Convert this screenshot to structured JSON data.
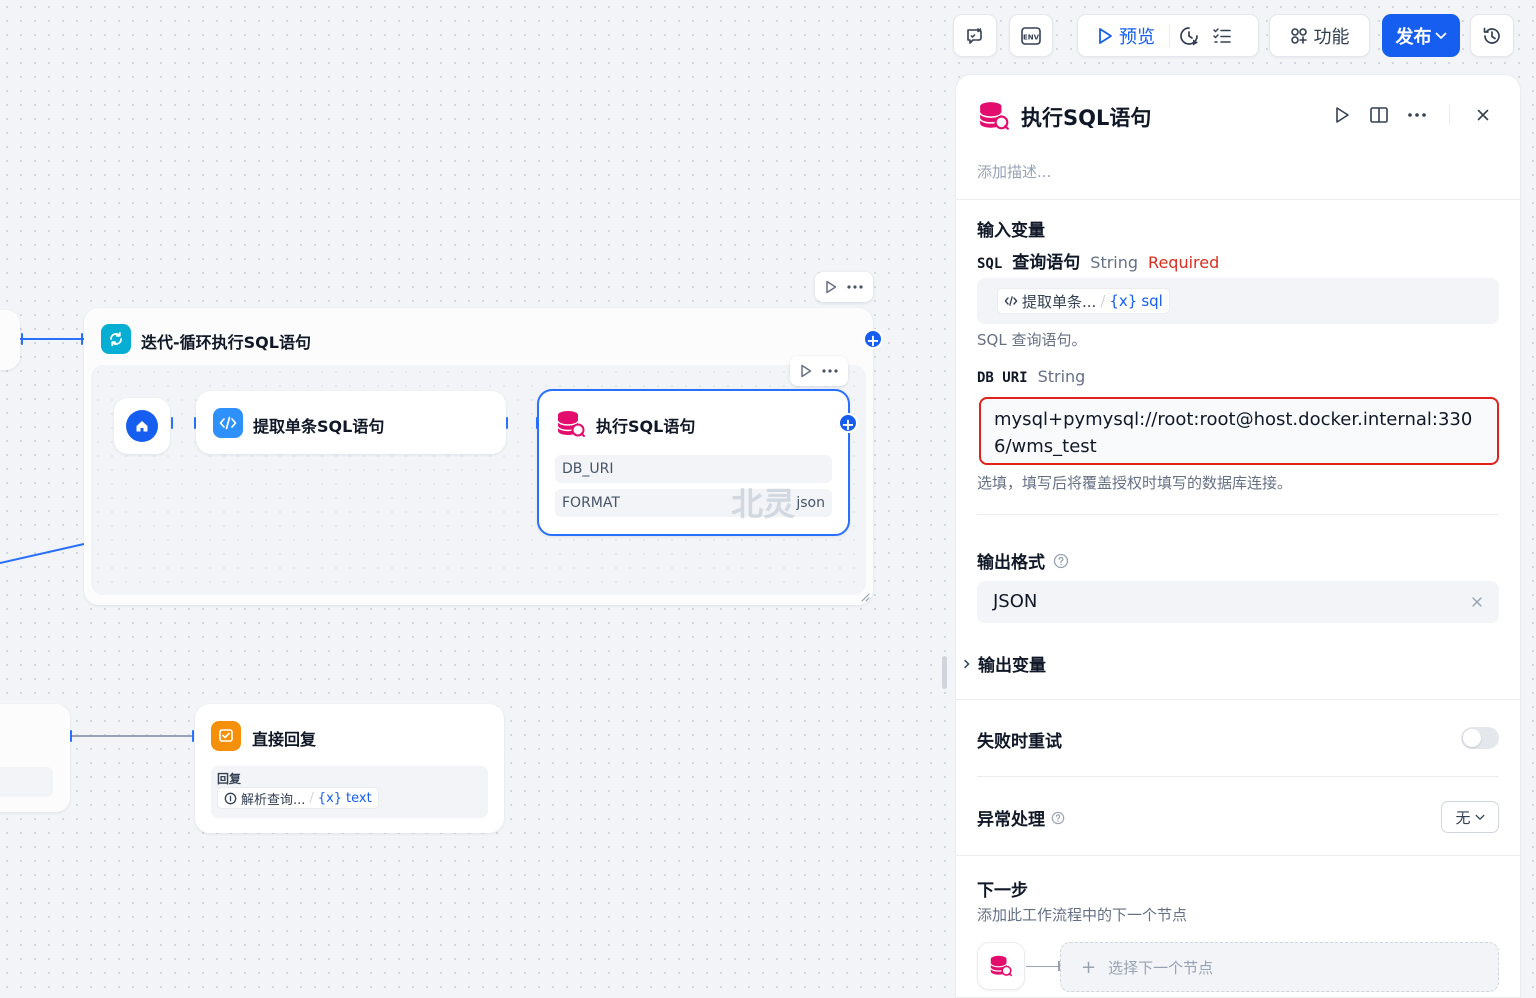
{
  "toolbar": {
    "preview_label": "预览",
    "features_label": "功能",
    "publish_label": "发布"
  },
  "canvas": {
    "iteration_node": {
      "title": "迭代-循环执行SQL语句"
    },
    "extract_node": {
      "title": "提取单条SQL语句"
    },
    "sql_node": {
      "title": "执行SQL语句",
      "fields": [
        {
          "label": "DB_URI",
          "value": ""
        },
        {
          "label": "FORMAT",
          "value": "json"
        }
      ],
      "watermark": "北灵"
    },
    "reply_node": {
      "title": "直接回复",
      "reply_label": "回复",
      "reply_source": "解析查询...",
      "reply_sep": "/",
      "reply_var": "text"
    }
  },
  "panel": {
    "title": "执行SQL语句",
    "description_placeholder": "添加描述...",
    "input_section_title": "输入变量",
    "sql_var": {
      "name": "SQL",
      "label": "查询语句",
      "type": "String",
      "required": "Required",
      "source_node": "提取单条...",
      "sep": "/",
      "source_var": "sql",
      "help": "SQL 查询语句。"
    },
    "db_uri_var": {
      "name": "DB URI",
      "type": "String",
      "value_line1": "mysql+pymysql://root:root@host.docker.internal:330",
      "value_line2": "6/wms_test",
      "help": "选填，填写后将覆盖授权时填写的数据库连接。"
    },
    "output_format": {
      "title": "输出格式",
      "value": "JSON"
    },
    "output_vars_title": "输出变量",
    "retry_title": "失败时重试",
    "error_handling": {
      "title": "异常处理",
      "value": "无"
    },
    "next_step": {
      "title": "下一步",
      "desc": "添加此工作流程中的下一个节点",
      "select_label": "选择下一个节点"
    }
  },
  "colors": {
    "accent": "#155eef",
    "required": "#d92d20",
    "highlight_border": "#e0211c",
    "sql_icon": "#e30d6e",
    "iteration_icon": "#06aed4",
    "reply_icon": "#f79009"
  }
}
